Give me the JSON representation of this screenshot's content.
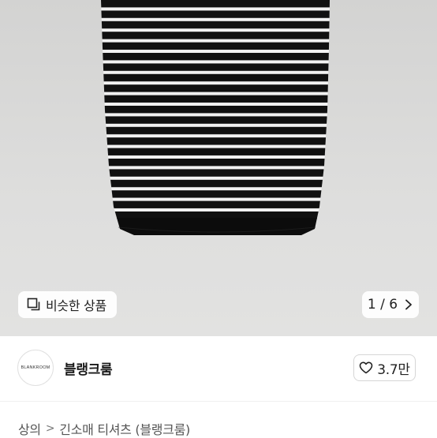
{
  "gallery": {
    "similar_label": "비슷한 상품",
    "counter": "1 / 6",
    "similar_icon": "similar-items-icon",
    "next_icon": "chevron-right-icon"
  },
  "shop": {
    "avatar_text": "BLANKROOM",
    "name": "블랭크룸",
    "like_count": "3.7만",
    "like_icon": "heart-outline-icon"
  },
  "breadcrumb": {
    "items": [
      "상의",
      "긴소매 티셔츠 (블랭크룸)"
    ],
    "separator": ">"
  },
  "colors": {
    "stripe_dark": "#111111",
    "stripe_light": "#f2f2f2",
    "hero_bg": "#dcdcdb"
  }
}
